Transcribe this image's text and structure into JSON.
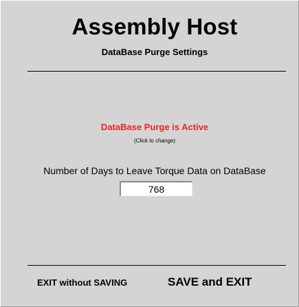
{
  "header": {
    "title": "Assembly Host",
    "subtitle": "DataBase Purge Settings"
  },
  "purge": {
    "status_label": "DataBase Purge is Active",
    "status_color": "#ee2222",
    "hint": "(Click to change)"
  },
  "days": {
    "label": "Number of Days to Leave Torque Data on DataBase",
    "value": "768"
  },
  "footer": {
    "exit_without_saving_label": "EXIT without SAVING",
    "save_and_exit_label": "SAVE and EXIT"
  }
}
